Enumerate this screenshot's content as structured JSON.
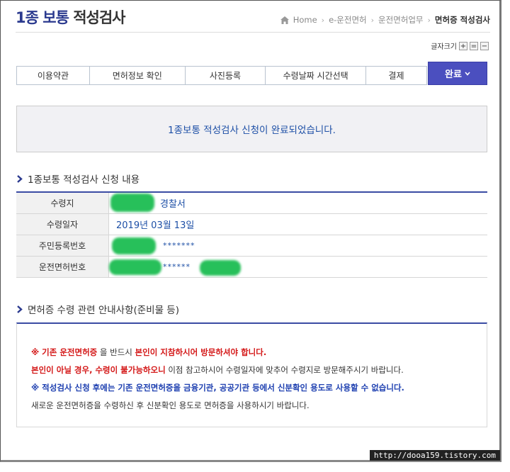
{
  "header": {
    "title_part1": "1종 보통",
    "title_part2": "적성검사",
    "breadcrumb": [
      "Home",
      "e-운전면허",
      "운전면허업무",
      "면허증 적성검사"
    ]
  },
  "font_size": {
    "label": "글자크기",
    "buttons": [
      "+",
      "=",
      "−"
    ]
  },
  "steps": {
    "items": [
      "이용약관",
      "면허정보 확인",
      "사진등록",
      "수령날짜 시간선택",
      "결제"
    ],
    "done_label": "완료"
  },
  "message": "1종보통 적성검사 신청이 완료되었습니다.",
  "application": {
    "section_title": "1종보통 적성검사 신청 내용",
    "rows": [
      {
        "label": "수령지",
        "value": "경찰서"
      },
      {
        "label": "수령일자",
        "value": "2019년 03월 13일"
      },
      {
        "label": "주민등록번호",
        "value": "*******"
      },
      {
        "label": "운전면허번호",
        "value": "******"
      }
    ]
  },
  "notice": {
    "section_title": "면허증 수령 관련 안내사항(준비물 등)",
    "line1_red1": "※ 기존 운전면허증",
    "line1_mid": " 을 반드시 ",
    "line1_red2": "본인이 지참하시어 방문하셔야 합니다.",
    "line2_red": "본인이 아닐 경우, 수령이 불가능하오니",
    "line2_rest": " 이점 참고하시어 수령일자에 맞추어 수령지로 방문해주시기 바랍니다.",
    "line3_blue": "※ 적성검사 신청 후에는 기존 운전면허증을 금융기관, 공공기관 등에서 신분확인 용도로 사용할 수 없습니다.",
    "line4": "새로운 운전면허증을 수령하신 후 신분확인 용도로 면허증을 사용하시기 바랍니다."
  },
  "watermark": "http://dooa159.tistory.com",
  "colors": {
    "accent": "#3a4ca3",
    "done_button": "#4b4fbf",
    "link_blue": "#1d4fa6",
    "warning_red": "#d41818"
  }
}
